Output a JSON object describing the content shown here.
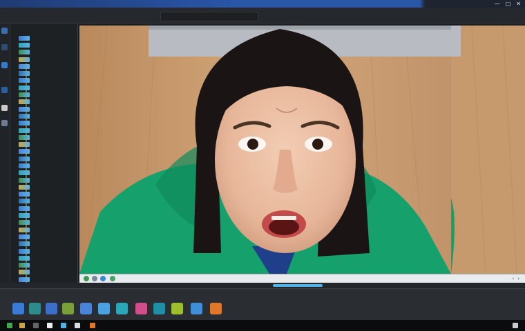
{
  "window": {
    "title": "",
    "controls": [
      "—",
      "□",
      "✕"
    ]
  },
  "menu": {
    "items": [
      "",
      "",
      "",
      "",
      "",
      ""
    ]
  },
  "sidebar": {
    "header": "",
    "rows": [
      "",
      "",
      "",
      "",
      "",
      "",
      "",
      "",
      "",
      "",
      "",
      "",
      "",
      "",
      "",
      "",
      "",
      "",
      "",
      "",
      "",
      "",
      "",
      "",
      "",
      "",
      "",
      "",
      "",
      "",
      "",
      "",
      "",
      "",
      ""
    ]
  },
  "preview": {
    "nav_prev": "‹",
    "nav_next": "›"
  },
  "taskbar": {
    "label_left": "",
    "apps": [
      "blue-app",
      "teal-app",
      "blue-app-2",
      "green-app",
      "blue-app-3",
      "sky-app",
      "cyan-app",
      "pink-app",
      "teal-app-2",
      "lime-app",
      "blue-app-4",
      "orange-app"
    ],
    "colors": [
      "#3a7bd5",
      "#2e8b8b",
      "#3d6fc9",
      "#7aa03c",
      "#4a84d8",
      "#4aa3e0",
      "#2aa7b8",
      "#d04f8a",
      "#1f8fa8",
      "#9cbf2e",
      "#3e8fd8",
      "#e0782a"
    ]
  },
  "colors": {
    "accent": "#2a56a8",
    "hoodie": "#14a36f",
    "floor": "#c49466"
  }
}
